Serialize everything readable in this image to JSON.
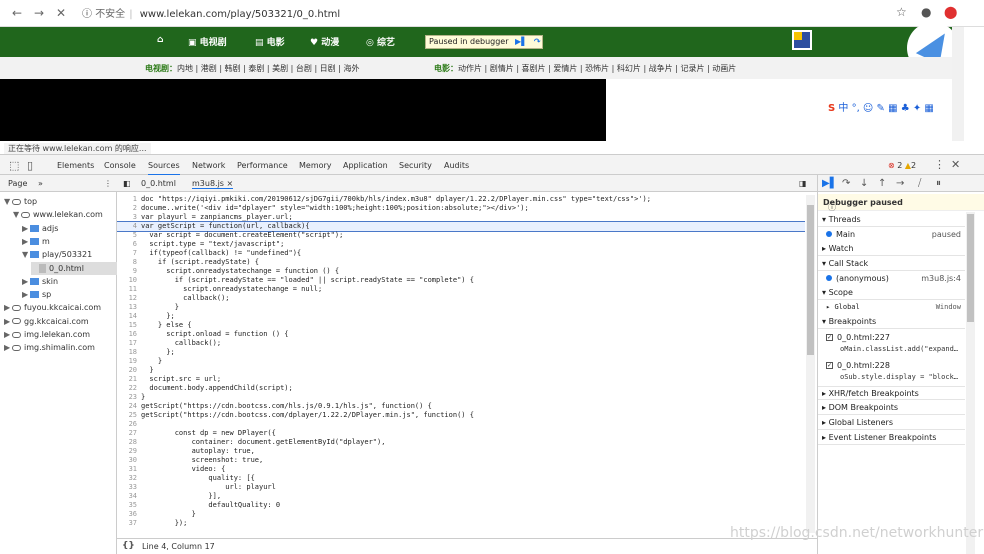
{
  "browser": {
    "back": "←",
    "forward": "→",
    "stop": "✕",
    "insecure_label": "不安全",
    "url": "www.lelekan.com/play/503321/0_0.html"
  },
  "site": {
    "nav_items": [
      "电视剧",
      "电影",
      "动漫",
      "综艺"
    ],
    "paused_banner": "Paused in debugger",
    "categories_tv_label": "电视剧：",
    "categories_tv": "内地 | 港剧 | 韩剧 | 泰剧 | 美剧 | 台剧 | 日剧 | 海外",
    "categories_movie_label": "电影：",
    "categories_movie": "动作片 | 剧情片 | 喜剧片 | 爱情片 | 恐怖片 | 科幻片 | 战争片 | 记录片 | 动画片",
    "ime": "中 °, ☺ ✎ ▦ ♣ ✦ ▦",
    "status": "正在等待 www.lelekan.com 的响应..."
  },
  "devtools": {
    "tabs": [
      "Elements",
      "Console",
      "Sources",
      "Network",
      "Performance",
      "Memory",
      "Application",
      "Security",
      "Audits"
    ],
    "active_tab": "Sources",
    "errors": "2",
    "warnings": "2",
    "navigator": {
      "tab": "Page",
      "more": "»",
      "tree": [
        {
          "label": "top",
          "kind": "frame",
          "indent": 0,
          "arrow": "▼"
        },
        {
          "label": "www.lelekan.com",
          "kind": "cloud",
          "indent": 1,
          "arrow": "▼"
        },
        {
          "label": "adjs",
          "kind": "folder",
          "indent": 2,
          "arrow": "▶"
        },
        {
          "label": "m",
          "kind": "folder",
          "indent": 2,
          "arrow": "▶"
        },
        {
          "label": "play/503321",
          "kind": "folder",
          "indent": 2,
          "arrow": "▼"
        },
        {
          "label": "0_0.html",
          "kind": "file",
          "indent": 3,
          "arrow": ""
        },
        {
          "label": "skin",
          "kind": "folder",
          "indent": 2,
          "arrow": "▶"
        },
        {
          "label": "sp",
          "kind": "folder",
          "indent": 2,
          "arrow": "▶"
        },
        {
          "label": "fuyou.kkcaicai.com",
          "kind": "cloud",
          "indent": 0,
          "arrow": "▶"
        },
        {
          "label": "gg.kkcaicai.com",
          "kind": "cloud",
          "indent": 0,
          "arrow": "▶"
        },
        {
          "label": "img.lelekan.com",
          "kind": "cloud",
          "indent": 0,
          "arrow": "▶"
        },
        {
          "label": "img.shimalin.com",
          "kind": "cloud",
          "indent": 0,
          "arrow": "▶"
        }
      ]
    },
    "editor": {
      "tabs": [
        "0_0.html",
        "m3u8.js ×"
      ],
      "status": "Line 4, Column 17",
      "lines": [
        "doc \"https://iqiyi.pmkiki.com/20190612/sjDG7gii/700kb/hls/index.m3u8\" dplayer/1.22.2/DPlayer.min.css\" type=\"text/css\">');",
        "docume..write('<div id=\"dplayer\" style=\"width:100%;height:100%;position:absolute;\"></div>');",
        "var playurl = zanpiancms_player.url;",
        "var getScript = function(url, callback){",
        "  var script = document.createElement(\"script\");",
        "  script.type = \"text/javascript\";",
        "  if(typeof(callback) != \"undefined\"){",
        "    if (script.readyState) {",
        "      script.onreadystatechange = function () {",
        "        if (script.readyState == \"loaded\" || script.readyState == \"complete\") {",
        "          script.onreadystatechange = null;",
        "          callback();",
        "        }",
        "      };",
        "    } else {",
        "      script.onload = function () {",
        "        callback();",
        "      };",
        "    }",
        "  }",
        "  script.src = url;",
        "  document.body.appendChild(script);",
        "}",
        "getScript(\"https://cdn.bootcss.com/hls.js/0.9.1/hls.js\", function() {",
        "getScript(\"https://cdn.bootcss.com/dplayer/1.22.2/DPlayer.min.js\", function() {",
        "",
        "        const dp = new DPlayer({",
        "            container: document.getElementById(\"dplayer\"),",
        "            autoplay: true,",
        "            screenshot: true,",
        "            video: {",
        "                quality: [{",
        "                    url: playurl",
        "                }],",
        "                defaultQuality: 0",
        "            }",
        "        });"
      ]
    },
    "sidebar": {
      "paused": "Debugger paused",
      "threads": "Threads",
      "thread_main": "Main",
      "thread_state": "paused",
      "watch": "Watch",
      "callstack": "Call Stack",
      "frame_name": "(anonymous)",
      "frame_loc": "m3u8.js:4",
      "scope": "Scope",
      "global": "Global",
      "global_val": "Window",
      "breakpoints": "Breakpoints",
      "bp1_loc": "0_0.html:227",
      "bp1_code": "oMain.classList.add(\"expand…",
      "bp2_loc": "0_0.html:228",
      "bp2_code": "oSub.style.display = \"block…",
      "xhr": "XHR/fetch Breakpoints",
      "dom": "DOM Breakpoints",
      "global_listeners": "Global Listeners",
      "event_listeners": "Event Listener Breakpoints"
    }
  },
  "watermark": "https://blog.csdn.net/networkhunter"
}
